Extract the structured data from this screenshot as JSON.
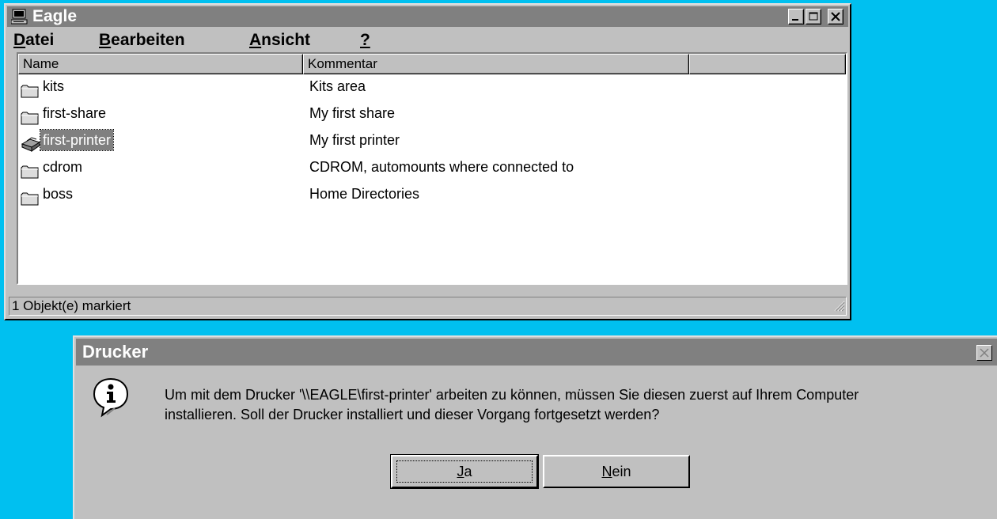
{
  "explorer": {
    "title": "Eagle",
    "menu": [
      {
        "mnemonic": "D",
        "rest": "atei"
      },
      {
        "mnemonic": "B",
        "rest": "earbeiten"
      },
      {
        "mnemonic": "A",
        "rest": "nsicht"
      },
      {
        "mnemonic": "?",
        "rest": ""
      }
    ],
    "columns": [
      "Name",
      "Kommentar",
      ""
    ],
    "rows": [
      {
        "name": "kits",
        "comment": "Kits area",
        "icon": "folder-icon",
        "selected": false
      },
      {
        "name": "first-share",
        "comment": "My first share",
        "icon": "folder-icon",
        "selected": false
      },
      {
        "name": "first-printer",
        "comment": "My first printer",
        "icon": "printer-icon",
        "selected": true
      },
      {
        "name": "cdrom",
        "comment": "CDROM, automounts where connected to",
        "icon": "folder-icon",
        "selected": false
      },
      {
        "name": "boss",
        "comment": "Home Directories",
        "icon": "folder-icon",
        "selected": false
      }
    ],
    "status": "1 Objekt(e) markiert"
  },
  "dialog": {
    "title": "Drucker",
    "icon": "info-icon",
    "message_line1": "Um mit dem Drucker '\\\\EAGLE\\first-printer' arbeiten zu können, müssen Sie diesen zuerst auf Ihrem Computer",
    "message_line2": "installieren. Soll der Drucker installiert und dieser Vorgang fortgesetzt werden?",
    "yes_mnemonic": "J",
    "yes_rest": "a",
    "no_mnemonic": "N",
    "no_rest": "ein"
  },
  "colors": {
    "desktop": "#00c0f0",
    "face": "#c0c0c0",
    "titlebar_inactive": "#808080",
    "selection": "#808080"
  }
}
